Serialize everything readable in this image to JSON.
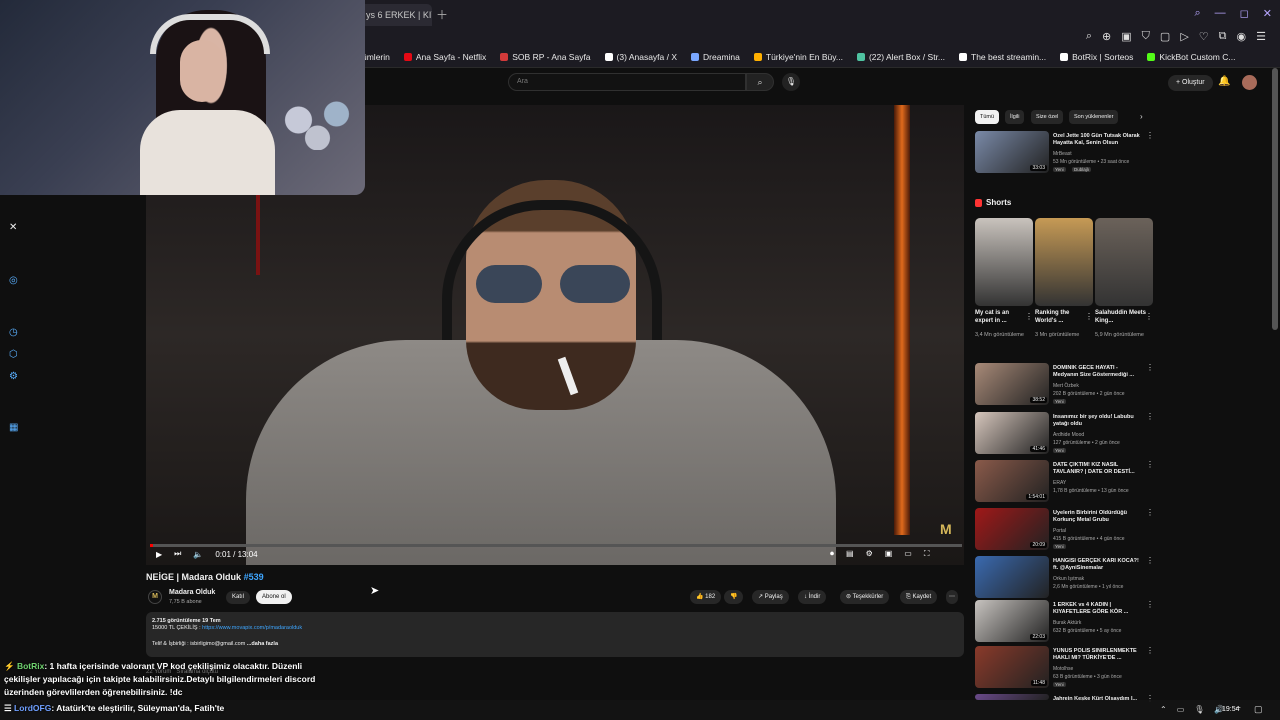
{
  "browser": {
    "active_tab": "ys 6 ERKEK | KIY",
    "new_tab_icon": "plus-icon"
  },
  "bookmarks": [
    {
      "label": "ümlerin",
      "icon_color": ""
    },
    {
      "label": "Ana Sayfa - Netflix",
      "icon_color": "#e50914"
    },
    {
      "label": "SOB RP - Ana Sayfa",
      "icon_color": "#d23a3a"
    },
    {
      "label": "(3) Anasayfa / X",
      "icon_color": "#ffffff"
    },
    {
      "label": "Dreamina",
      "icon_color": "#7aa7ff"
    },
    {
      "label": "Türkiye'nin En Büy...",
      "icon_color": "#ffb000"
    },
    {
      "label": "(22) Alert Box / Str...",
      "icon_color": "#4fc3a1"
    },
    {
      "label": "The best streamin...",
      "icon_color": "#ffffff"
    },
    {
      "label": "BotRix | Sorteos",
      "icon_color": "#ffffff"
    },
    {
      "label": "KickBot Custom C...",
      "icon_color": "#53fc18"
    }
  ],
  "search": {
    "placeholder": "Ara"
  },
  "header": {
    "create_label": "+ Oluştur"
  },
  "video": {
    "time": "0:01 / 13:04",
    "progress_fraction": 0.0013,
    "title": "NEİGE | Madara Olduk",
    "hashtag": "#539",
    "watermark": "M"
  },
  "channel": {
    "name": "Madara Olduk",
    "subs": "7,75 B abone",
    "join_label": "Katıl",
    "subscribe_label": "Abone ol"
  },
  "actions": {
    "likes": "182",
    "share": "Paylaş",
    "download": "İndir",
    "thanks": "Teşekkürler",
    "save": "Kaydet"
  },
  "description": {
    "stats": "2.715 görüntüleme  19 Tem",
    "giveaway": "15000 TL ÇEKİLİŞ : ",
    "link": "https://www.movapix.com/p/madaraolduk",
    "contact": "Telif & İşbirliği : isbirligimo@gmail.com",
    "more": "...daha fazla"
  },
  "comments": {
    "count": "22 Yorum",
    "sort": "Sıralama ölçütü"
  },
  "chat": [
    {
      "user": "BotRix",
      "text": ": 1 hafta içerisinde valorant VP kod çekilişimiz olacaktır. Düzenli çekilişler yapılacağı için takipte kalabilirsiniz.Detaylı bilgilendirmeleri discord üzerinden görevlilerden öğrenebilirsiniz. !dc"
    },
    {
      "user": "LordOFG",
      "text": ": Atatürk'te eleştirilir, Süleyman'da, Fatih'te"
    }
  ],
  "filters": [
    "Tümü",
    "İlgili",
    "Size özel",
    "Son yüklenenler"
  ],
  "shorts": {
    "heading": "Shorts",
    "items": [
      {
        "title": "My cat is an expert in ...",
        "views": "3,4 Mn görüntüleme",
        "color": "#c9c3bd"
      },
      {
        "title": "Ranking the World's ...",
        "views": "3 Mn görüntüleme",
        "color": "#c69a55"
      },
      {
        "title": "Salahuddin Meets King...",
        "views": "5,9 Mn görüntüleme",
        "color": "#6b625a"
      }
    ]
  },
  "recommendations": [
    {
      "title": "Özel Jette 100 Gün Tutsak Olarak Hayatta Kal, Senin Olsun",
      "channel": "MrBeast",
      "meta": "53 Mn görüntüleme • 23 saat önce",
      "badge": "Yeni",
      "badge2": "Dublajlı",
      "duration": "33:03",
      "color": "#7a8aa8"
    },
    {
      "title": "DOMİNİK GECE HAYATI - Medyanın Size Göstermediği ...",
      "channel": "Mert Özbek",
      "meta": "202 B görüntüleme • 2 gün önce",
      "badge": "Yeni",
      "duration": "38:52",
      "color": "#a88a78"
    },
    {
      "title": "İnsanımız bir şey oldu! Labubu yatağı oldu",
      "channel": "Ardhide Mood",
      "meta": "127 görüntüleme • 2 gün önce",
      "badge": "Yeni",
      "duration": "41:46",
      "color": "#d6c6bc"
    },
    {
      "title": "DATE ÇIKTIM! KIZ NASIL TAVLANIR? | DATE OR DESTİ...",
      "channel": "ERAY",
      "meta": "1,78 B görüntüleme • 13 gün önce",
      "badge": "",
      "duration": "1:54:01",
      "color": "#8a5a4a"
    },
    {
      "title": "Üyelerin Birbirini Öldürdüğü Korkunç Metal Grubu",
      "channel": "Portal",
      "meta": "415 B görüntüleme • 4 gün önce",
      "badge": "Yeni",
      "duration": "20:09",
      "color": "#a01818"
    },
    {
      "title": "HANGİSİ GERÇEK KARI KOCA?! ft. @AyniSinemalar",
      "channel": "Orkun Işıtmak",
      "meta": "2,6 Mn görüntüleme • 1 yıl önce",
      "badge": "",
      "duration": "",
      "color": "#3a6ab0"
    },
    {
      "title": "1 ERKEK vs 4 KADIN | KIYAFETLERE GÖRE KÖR ...",
      "channel": "Burak Aktürk",
      "meta": "632 B görüntüleme • 5 ay önce",
      "badge": "",
      "duration": "22:03",
      "color": "#c7c3bf"
    },
    {
      "title": "YUNUS POLİS SİNİRLENMEKTE HAKLI MI? TÜRKİYE'DE ...",
      "channel": "Motolhse",
      "meta": "63 B görüntüleme • 3 gün önce",
      "badge": "Yeni",
      "duration": "11:48",
      "color": "#8a3a2a"
    },
    {
      "title": "Jahrein Keşke Kürt Olsaydım İ...",
      "channel": "",
      "meta": "",
      "badge": "",
      "duration": "",
      "color": "#6a4a8a"
    }
  ],
  "taskbar": {
    "clock": "19:54"
  }
}
